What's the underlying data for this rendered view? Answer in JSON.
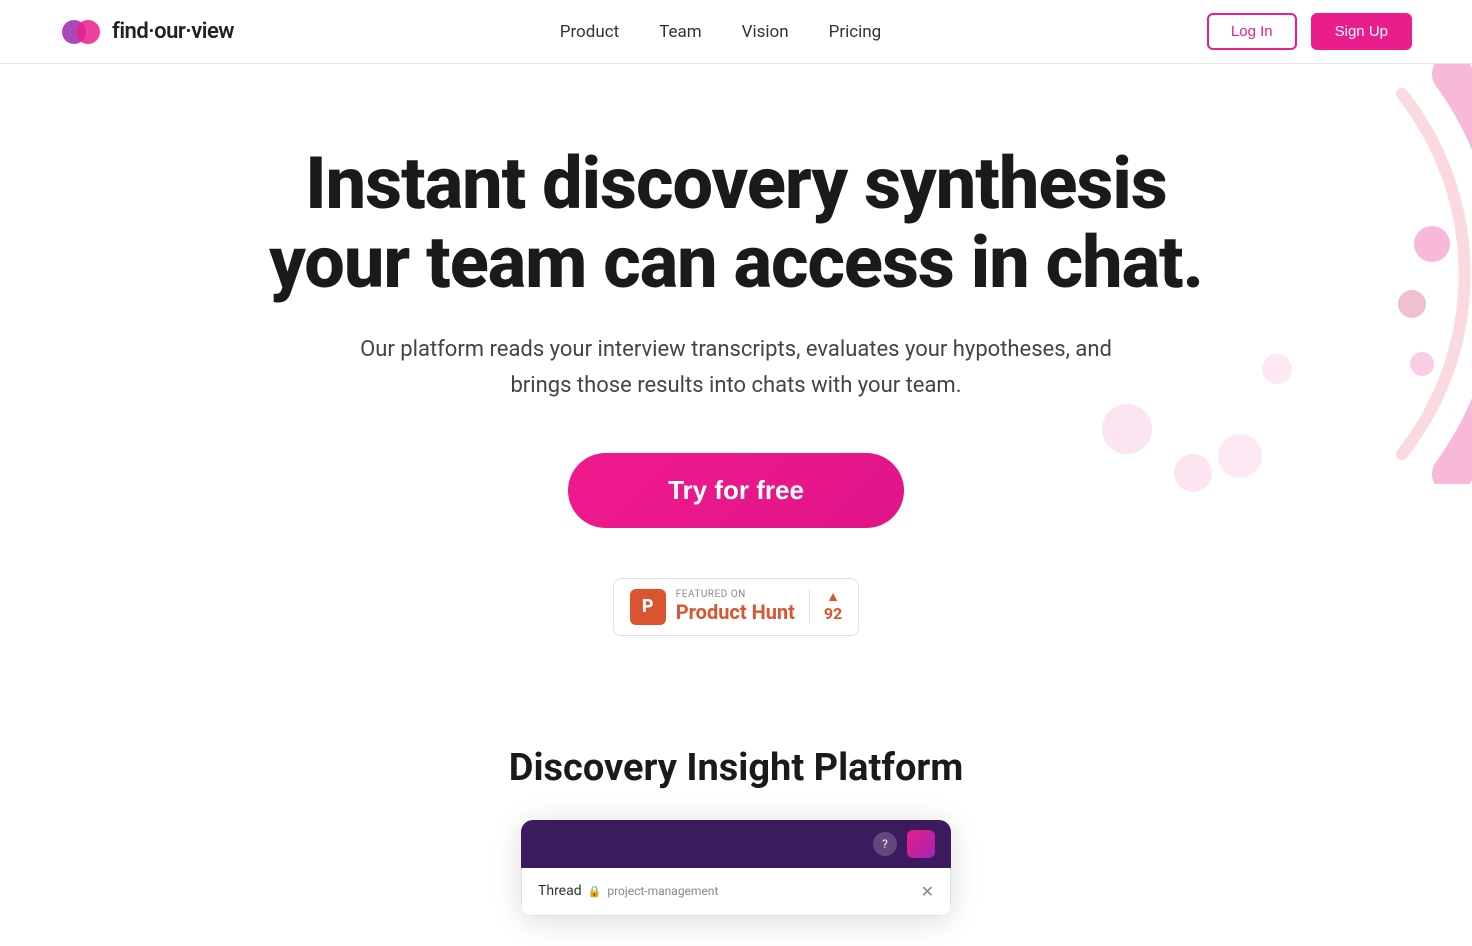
{
  "header": {
    "logo_text": "find·our·view",
    "nav": {
      "items": [
        {
          "label": "Product",
          "id": "product"
        },
        {
          "label": "Team",
          "id": "team"
        },
        {
          "label": "Vision",
          "id": "vision"
        },
        {
          "label": "Pricing",
          "id": "pricing"
        }
      ]
    },
    "login_label": "Log In",
    "signup_label": "Sign Up"
  },
  "hero": {
    "title_line1": "Instant discovery synthesis",
    "title_line2": "your team can access in chat.",
    "subtitle": "Our platform reads your interview transcripts, evaluates your hypotheses, and brings those results into chats with your team.",
    "cta_label": "Try for free"
  },
  "product_hunt": {
    "featured_text": "FEATURED ON",
    "name": "Product Hunt",
    "votes": "92",
    "icon_letter": "P"
  },
  "discovery": {
    "title": "Discovery Insight Platform"
  },
  "app_preview": {
    "thread_label": "Thread",
    "channel": "project-management"
  }
}
